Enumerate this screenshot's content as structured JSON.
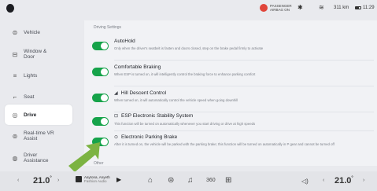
{
  "status": {
    "airbag_line1": "PASSENGER",
    "airbag_line2": "AIRBAG ON",
    "range": "311 km",
    "time": "11:29"
  },
  "sidebar": {
    "items": [
      {
        "label": "Vehicle",
        "icon": "car-icon"
      },
      {
        "label": "Window & Door",
        "icon": "door-icon"
      },
      {
        "label": "Lights",
        "icon": "light-icon"
      },
      {
        "label": "Seat",
        "icon": "seat-icon"
      },
      {
        "label": "Drive",
        "icon": "steering-wheel-icon",
        "active": true
      },
      {
        "label": "Real-time VR Assist",
        "icon": "camera-icon"
      },
      {
        "label": "Driver Assistance",
        "icon": "assist-icon"
      }
    ]
  },
  "main": {
    "section_title": "Driving Settings",
    "settings": [
      {
        "title": "AutoHold",
        "desc": "Only when the driver's seatbelt is fasten and doors closed, step on the brake pedal firmly to activate",
        "on": true
      },
      {
        "title": "Comfortable Braking",
        "desc": "When ESP is turned on, it will intelligently control the braking force to enhance parking comfort",
        "on": true
      },
      {
        "title": "Hill Descent Control",
        "desc": "When turned on, it will automatically control the vehicle speed when going downhill",
        "on": true
      },
      {
        "title": "ESP Electronic Stability System",
        "desc": "This function will be turned on automatically whenever you start driving or drive at high speeds",
        "on": true
      },
      {
        "title": "Electronic Parking Brake",
        "desc": "After it is turned on, the vehicle will be parked with the parking brake; this function will be turned on automatically in P gear and cannot be turned off",
        "on": true
      }
    ],
    "other_title": "Other"
  },
  "dock": {
    "left_temp": "21.0",
    "right_temp": "21.0",
    "temp_unit": "°",
    "track_title": "Aaytona, Anyeth",
    "track_subtitle": "Fashion Audio"
  },
  "colors": {
    "toggle_on": "#16a34a",
    "arrow": "#7cb342"
  }
}
